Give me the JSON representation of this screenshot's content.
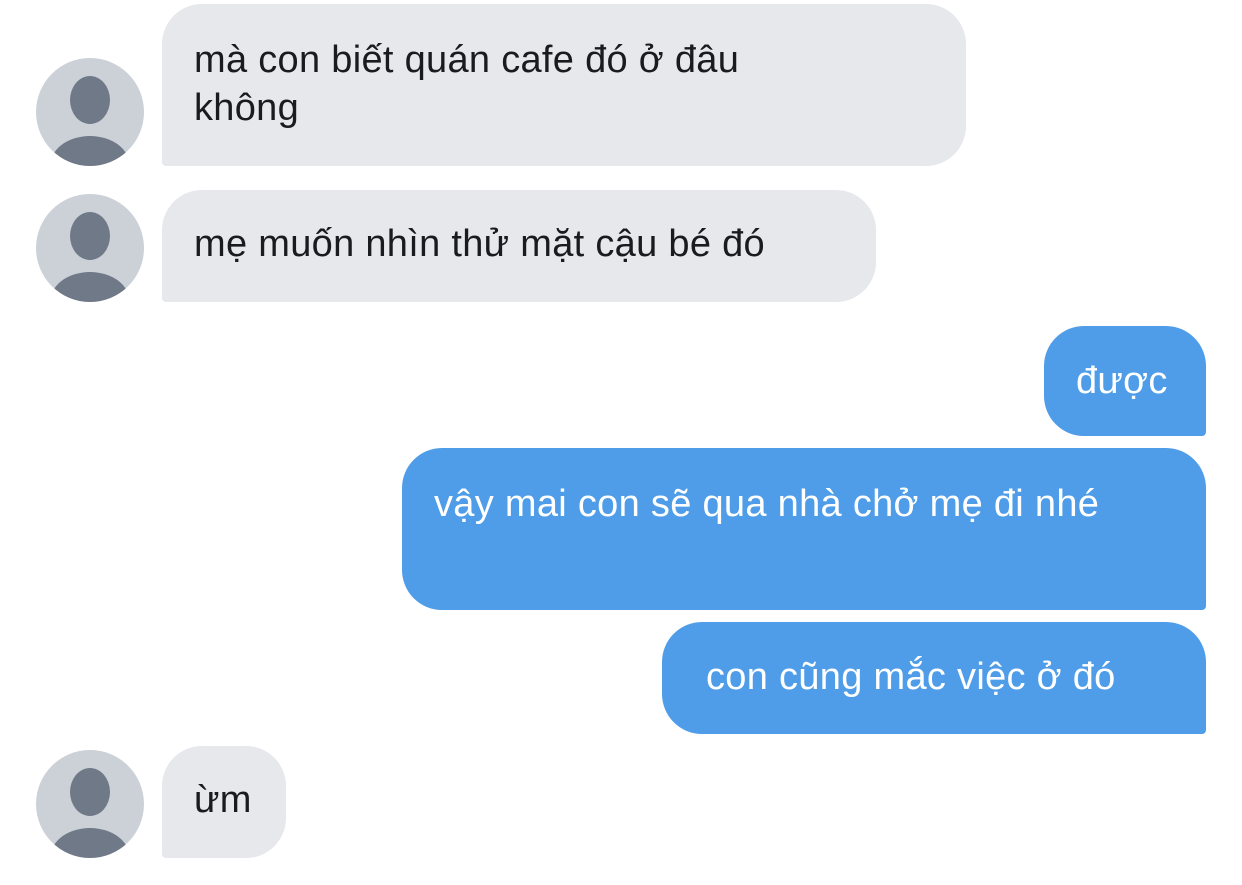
{
  "colors": {
    "incoming_bubble": "#e6e8ec",
    "outgoing_bubble": "#4f9de8",
    "incoming_text": "#1b1b1d",
    "outgoing_text": "#ffffff",
    "avatar_bg": "#ccd1d8",
    "avatar_figure": "#6f7987"
  },
  "avatar_icon": "default-user-silhouette",
  "messages": [
    {
      "direction": "incoming",
      "text": "mà con biết quán cafe đó ở đâu không"
    },
    {
      "direction": "incoming",
      "text": "mẹ muốn nhìn thử mặt cậu bé đó"
    },
    {
      "direction": "outgoing",
      "text": "được"
    },
    {
      "direction": "outgoing",
      "text": "vậy mai con sẽ qua nhà chở mẹ đi nhé"
    },
    {
      "direction": "outgoing",
      "text": "con cũng mắc việc ở đó"
    },
    {
      "direction": "incoming",
      "text": "ừm"
    }
  ]
}
